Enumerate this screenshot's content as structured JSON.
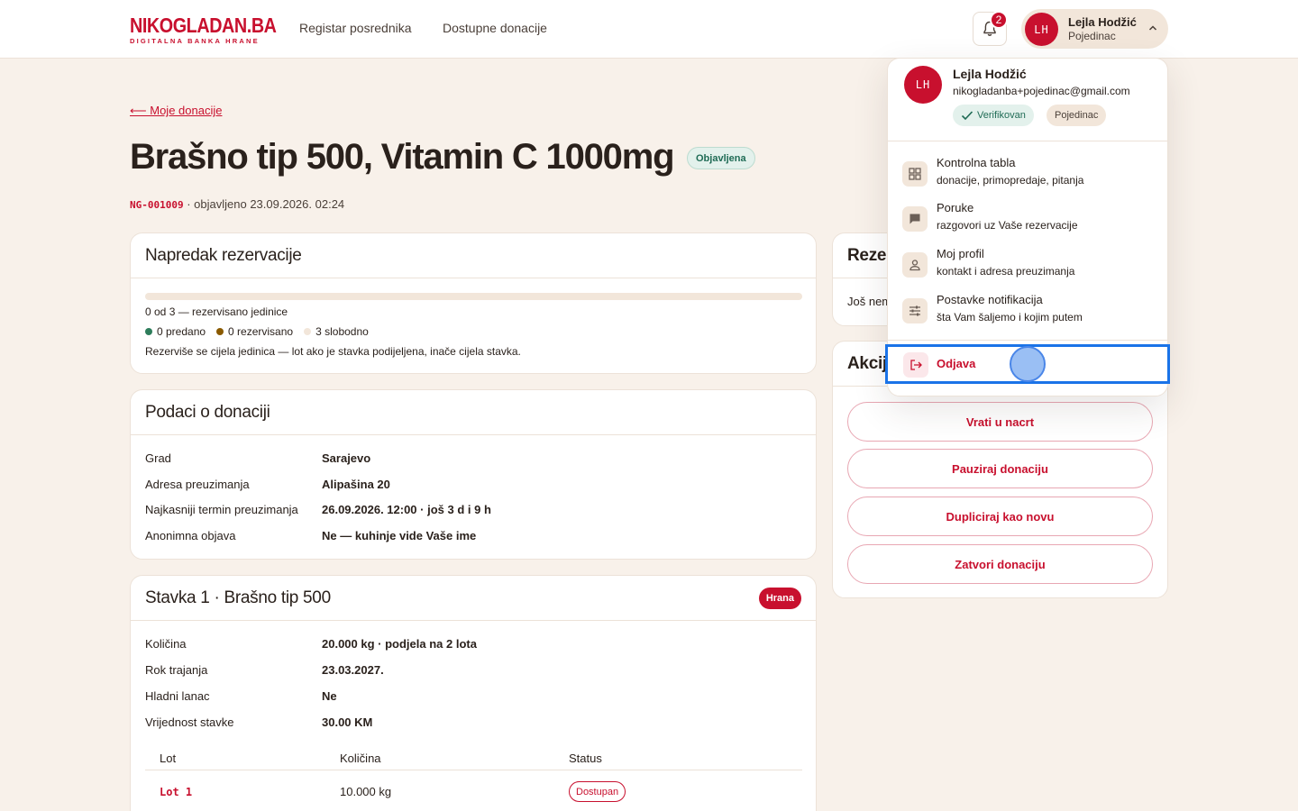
{
  "header": {
    "logo_main": "NIKOGLADAN.BA",
    "logo_sub": "DIGITALNA BANKA HRANE",
    "nav": [
      "Registar posrednika",
      "Dostupne donacije"
    ],
    "notifications_count": "2",
    "user": {
      "initials": "LH",
      "name": "Lejla Hodžić",
      "role": "Pojedinac"
    }
  },
  "page": {
    "back_label": "⟵ Moje donacije",
    "title": "Brašno tip 500, Vitamin C 1000mg",
    "status": "Objavljena",
    "ref": "NG-001009",
    "published": "· objavljeno 23.09.2026. 02:24"
  },
  "progress_card": {
    "title": "Napredak rezervacije",
    "reserved_fraction": 0,
    "summary": "0 od 3 — rezervisano jedinice",
    "legend": [
      {
        "label": "0 predano",
        "color": "#2e7d5b"
      },
      {
        "label": "0 rezervisano",
        "color": "#8a5a00"
      },
      {
        "label": "3 slobodno",
        "color": "#f2e6da"
      }
    ],
    "note": "Rezerviše se cijela jedinica — lot ako je stavka podijeljena, inače cijela stavka."
  },
  "details_card": {
    "title": "Podaci o donaciji",
    "rows": [
      {
        "key": "Grad",
        "value": "Sarajevo"
      },
      {
        "key": "Adresa preuzimanja",
        "value": "Alipašina 20"
      },
      {
        "key": "Najkasniji termin preuzimanja",
        "value": "26.09.2026. 12:00 · još 3 d i 9 h"
      },
      {
        "key": "Anonimna objava",
        "value": "Ne — kuhinje vide Vaše ime"
      }
    ]
  },
  "item_card": {
    "title": "Stavka 1 · Brašno tip 500",
    "category": "Hrana",
    "rows": [
      {
        "key": "Količina",
        "value": "20.000 kg · podjela na 2 lota"
      },
      {
        "key": "Rok trajanja",
        "value": "23.03.2027."
      },
      {
        "key": "Hladni lanac",
        "value": "Ne"
      },
      {
        "key": "Vrijednost stavke",
        "value": "30.00 KM"
      }
    ],
    "lot_headers": [
      "Lot",
      "Količina",
      "Status"
    ],
    "lots": [
      {
        "lot": "Lot 1",
        "qty": "10.000 kg",
        "status": "Dostupan"
      }
    ]
  },
  "side": {
    "reservations_title": "Rezer",
    "reservations_text": "Još nem",
    "actions_title": "Akcij",
    "actions": [
      "Vrati u nacrt",
      "Pauziraj donaciju",
      "Dupliciraj kao novu",
      "Zatvori donaciju"
    ]
  },
  "dropdown": {
    "initials": "LH",
    "name": "Lejla Hodžić",
    "email": "nikogladanba+pojedinac@gmail.com",
    "verified": "Verifikovan",
    "role": "Pojedinac",
    "items": [
      {
        "label": "Kontrolna tabla",
        "sub": "donacije, primopredaje, pitanja",
        "icon": "grid-icon"
      },
      {
        "label": "Poruke",
        "sub": "razgovori uz Vaše rezervacije",
        "icon": "chat-icon"
      },
      {
        "label": "Moj profil",
        "sub": "kontakt i adresa preuzimanja",
        "icon": "person-icon"
      },
      {
        "label": "Postavke notifikacija",
        "sub": "šta Vam šaljemo i kojim putem",
        "icon": "sliders-icon"
      }
    ],
    "logout": "Odjava"
  },
  "colors": {
    "brand": "#c8102e",
    "background": "#f8f1ea",
    "focus": "#1a73e8"
  }
}
